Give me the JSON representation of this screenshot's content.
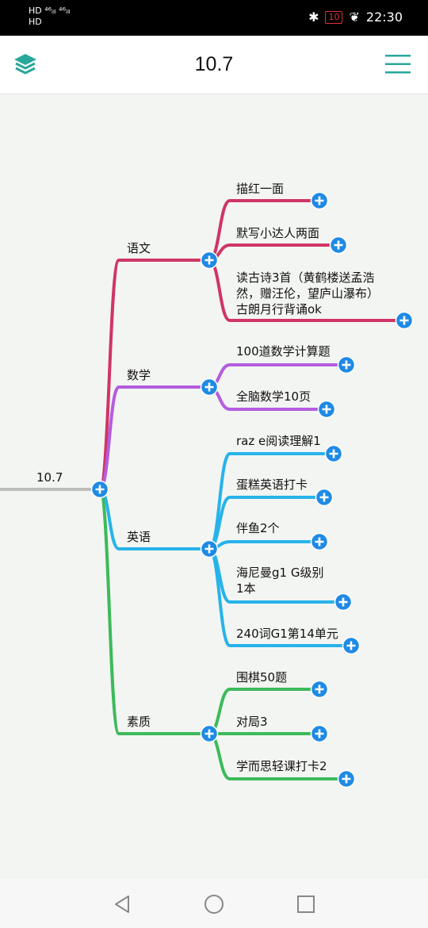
{
  "status": {
    "left_line1": "HD ⁴⁶ᵢₗₗ ⁴⁶ᵢₗₗ",
    "left_line2": "HD",
    "battery": "10",
    "time": "22:30"
  },
  "header": {
    "title": "10.7"
  },
  "mindmap": {
    "root": "10.7",
    "branches": [
      {
        "label": "语文",
        "color": "#cf3566",
        "children": [
          {
            "lines": [
              "描红一面"
            ]
          },
          {
            "lines": [
              "默写小达人两面"
            ]
          },
          {
            "lines": [
              "读古诗3首（黄鹤楼送孟浩",
              "然，赠汪伦，望庐山瀑布）",
              "古朗月行背诵ok"
            ]
          }
        ]
      },
      {
        "label": "数学",
        "color": "#b55ce0",
        "children": [
          {
            "lines": [
              "100道数学计算题"
            ]
          },
          {
            "lines": [
              "全脑数学10页"
            ]
          }
        ]
      },
      {
        "label": "英语",
        "color": "#27b3ea",
        "children": [
          {
            "lines": [
              "raz e阅读理解1"
            ]
          },
          {
            "lines": [
              "蛋糕英语打卡"
            ]
          },
          {
            "lines": [
              "伴鱼2个"
            ]
          },
          {
            "lines": [
              "海尼曼g1 G级别",
              "1本"
            ]
          },
          {
            "lines": [
              "240词G1第14单元"
            ]
          }
        ]
      },
      {
        "label": "素质",
        "color": "#3dba5a",
        "children": [
          {
            "lines": [
              "围棋50题"
            ]
          },
          {
            "lines": [
              "对局3"
            ]
          },
          {
            "lines": [
              "学而思轻课打卡2"
            ]
          }
        ]
      }
    ]
  },
  "colors": {
    "accent": "#1f8ae5",
    "teal": "#2aa79b",
    "root_line": "#bdbdbd"
  },
  "icons": {
    "layers": "layers-icon",
    "menu": "hamburger-menu-icon",
    "expand": "plus-circle-icon",
    "back": "back-triangle-icon",
    "home": "home-circle-icon",
    "recents": "recents-square-icon"
  }
}
